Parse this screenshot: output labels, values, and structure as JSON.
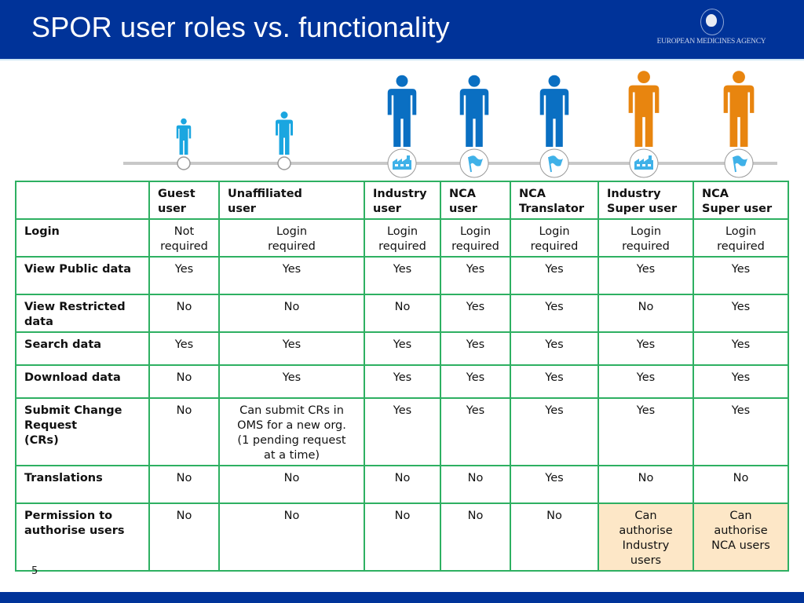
{
  "header": {
    "title": "SPOR user roles vs. functionality",
    "logo_text": "EUROPEAN MEDICINES AGENCY"
  },
  "colors": {
    "header_bg": "#003399",
    "grid_border": "#2eb062",
    "highlight_bg": "#fde7c7",
    "light_blue_user": "#1aa6e0",
    "blue_user": "#0a6fc2",
    "orange_user": "#e8850f",
    "badge_icon": "#3fb1e8"
  },
  "timeline": {
    "users": [
      {
        "role": "Guest user",
        "color": "light_blue",
        "badge": "empty-circle"
      },
      {
        "role": "Unaffiliated user",
        "color": "light_blue",
        "badge": "empty-circle"
      },
      {
        "role": "Industry user",
        "color": "blue",
        "badge": "factory-icon"
      },
      {
        "role": "NCA user",
        "color": "blue",
        "badge": "flag-icon"
      },
      {
        "role": "NCA Translator",
        "color": "blue",
        "badge": "flag-icon"
      },
      {
        "role": "Industry Super user",
        "color": "orange",
        "badge": "factory-icon"
      },
      {
        "role": "NCA Super user",
        "color": "orange",
        "badge": "flag-icon"
      }
    ]
  },
  "table": {
    "columns": [
      {
        "line1": "Guest",
        "line2": "user"
      },
      {
        "line1": "Unaffiliated",
        "line2": "user"
      },
      {
        "line1": "Industry",
        "line2": "user"
      },
      {
        "line1": "NCA",
        "line2": "user"
      },
      {
        "line1": "NCA",
        "line2": "Translator"
      },
      {
        "line1": "Industry",
        "line2": "Super user"
      },
      {
        "line1": "NCA",
        "line2": "Super user"
      }
    ],
    "rows": [
      {
        "label": [
          "Login"
        ],
        "cells": [
          [
            "Not",
            "required"
          ],
          [
            "Login",
            "required"
          ],
          [
            "Login",
            "required"
          ],
          [
            "Login",
            "required"
          ],
          [
            "Login",
            "required"
          ],
          [
            "Login",
            "required"
          ],
          [
            "Login",
            "required"
          ]
        ]
      },
      {
        "label": [
          "View Public data"
        ],
        "cells": [
          [
            "Yes"
          ],
          [
            "Yes"
          ],
          [
            "Yes"
          ],
          [
            "Yes"
          ],
          [
            "Yes"
          ],
          [
            "Yes"
          ],
          [
            "Yes"
          ]
        ]
      },
      {
        "label": [
          "View Restricted",
          "data"
        ],
        "cells": [
          [
            "No"
          ],
          [
            "No"
          ],
          [
            "No"
          ],
          [
            "Yes"
          ],
          [
            "Yes"
          ],
          [
            "No"
          ],
          [
            "Yes"
          ]
        ]
      },
      {
        "label": [
          "Search data"
        ],
        "cells": [
          [
            "Yes"
          ],
          [
            "Yes"
          ],
          [
            "Yes"
          ],
          [
            "Yes"
          ],
          [
            "Yes"
          ],
          [
            "Yes"
          ],
          [
            "Yes"
          ]
        ]
      },
      {
        "label": [
          "Download data"
        ],
        "cells": [
          [
            "No"
          ],
          [
            "Yes"
          ],
          [
            "Yes"
          ],
          [
            "Yes"
          ],
          [
            "Yes"
          ],
          [
            "Yes"
          ],
          [
            "Yes"
          ]
        ]
      },
      {
        "label": [
          "Submit Change",
          "Request",
          "(CRs)"
        ],
        "cells": [
          [
            "No"
          ],
          [
            "Can submit CRs in",
            "OMS for a new org.",
            "(1 pending request",
            "at a time)"
          ],
          [
            "Yes"
          ],
          [
            "Yes"
          ],
          [
            "Yes"
          ],
          [
            "Yes"
          ],
          [
            "Yes"
          ]
        ]
      },
      {
        "label": [
          "Translations"
        ],
        "cells": [
          [
            "No"
          ],
          [
            "No"
          ],
          [
            "No"
          ],
          [
            "No"
          ],
          [
            "Yes"
          ],
          [
            "No"
          ],
          [
            "No"
          ]
        ]
      },
      {
        "label": [
          "Permission to",
          "authorise users"
        ],
        "cells": [
          [
            "No"
          ],
          [
            "No"
          ],
          [
            "No"
          ],
          [
            "No"
          ],
          [
            "No"
          ],
          [
            "Can",
            "authorise",
            "Industry",
            "users"
          ],
          [
            "Can",
            "authorise",
            "NCA users"
          ]
        ]
      }
    ]
  },
  "footer": {
    "page_number": "5"
  }
}
